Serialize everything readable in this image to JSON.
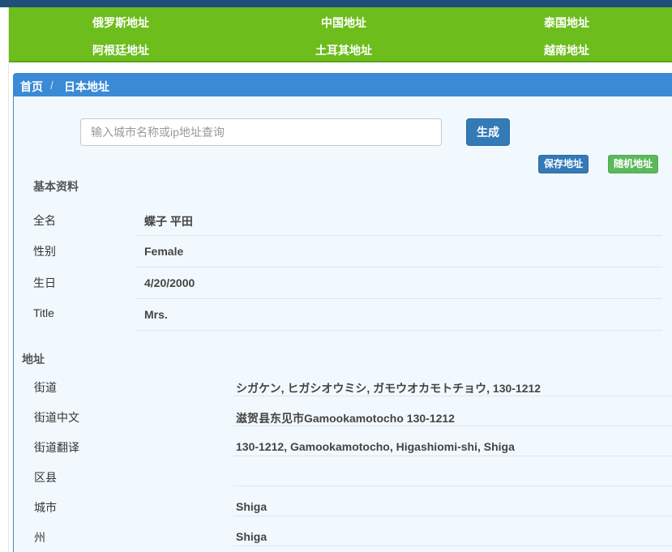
{
  "nav": {
    "items": [
      "俄罗斯地址",
      "中国地址",
      "泰国地址",
      "阿根廷地址",
      "土耳其地址",
      "越南地址"
    ]
  },
  "breadcrumb": {
    "home": "首页",
    "separator": "/",
    "current": "日本地址"
  },
  "search": {
    "placeholder": "输入城市名称或ip地址查询",
    "value": ""
  },
  "buttons": {
    "generate": "生成",
    "save": "保存地址",
    "random": "随机地址"
  },
  "basic": {
    "title": "基本资料",
    "rows": [
      {
        "label": "全名",
        "value": "蝶子 平田"
      },
      {
        "label": "性别",
        "value": "Female"
      },
      {
        "label": "生日",
        "value": "4/20/2000"
      },
      {
        "label": "Title",
        "value": "Mrs."
      }
    ]
  },
  "address": {
    "title": "地址",
    "rows": [
      {
        "label": "街道",
        "value": "シガケン, ヒガシオウミシ, ガモウオカモトチョウ, 130-1212"
      },
      {
        "label": "街道中文",
        "value": "滋贺县东见市Gamookamotocho 130-1212"
      },
      {
        "label": "街道翻译",
        "value": "130-1212, Gamookamotocho, Higashiomi-shi, Shiga"
      },
      {
        "label": "区县",
        "value": ""
      },
      {
        "label": "城市",
        "value": "Shiga"
      },
      {
        "label": "州",
        "value": "Shiga"
      }
    ]
  }
}
